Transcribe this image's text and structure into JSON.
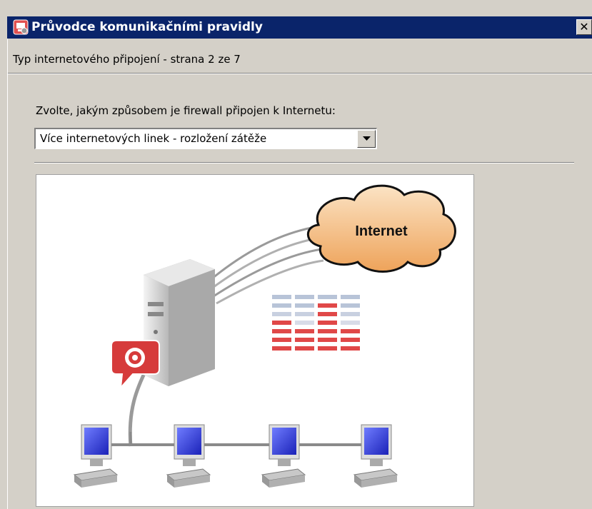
{
  "window": {
    "title": "Průvodce komunikačními pravidly",
    "close_glyph": "✕",
    "icon": "wizard-app-icon"
  },
  "header": {
    "subtitle": "Typ internetového připojení - strana 2 ze 7"
  },
  "main": {
    "question": "Zvolte, jakým způsobem je firewall připojen k Internetu:",
    "connection_type": {
      "selected": "Více internetových linek - rozložení zátěže",
      "dropdown_icon": "chevron-down-icon"
    },
    "illustration": {
      "cloud_label": "Internet",
      "icons": [
        "cloud-icon",
        "server-icon",
        "firewall-badge-icon",
        "load-balance-bars-icon",
        "computer-icon"
      ]
    }
  },
  "colors": {
    "titlebar": "#0a246a",
    "window_bg": "#d4d0c8",
    "accent_red": "#d93636",
    "cloud": "#f5c58e"
  }
}
